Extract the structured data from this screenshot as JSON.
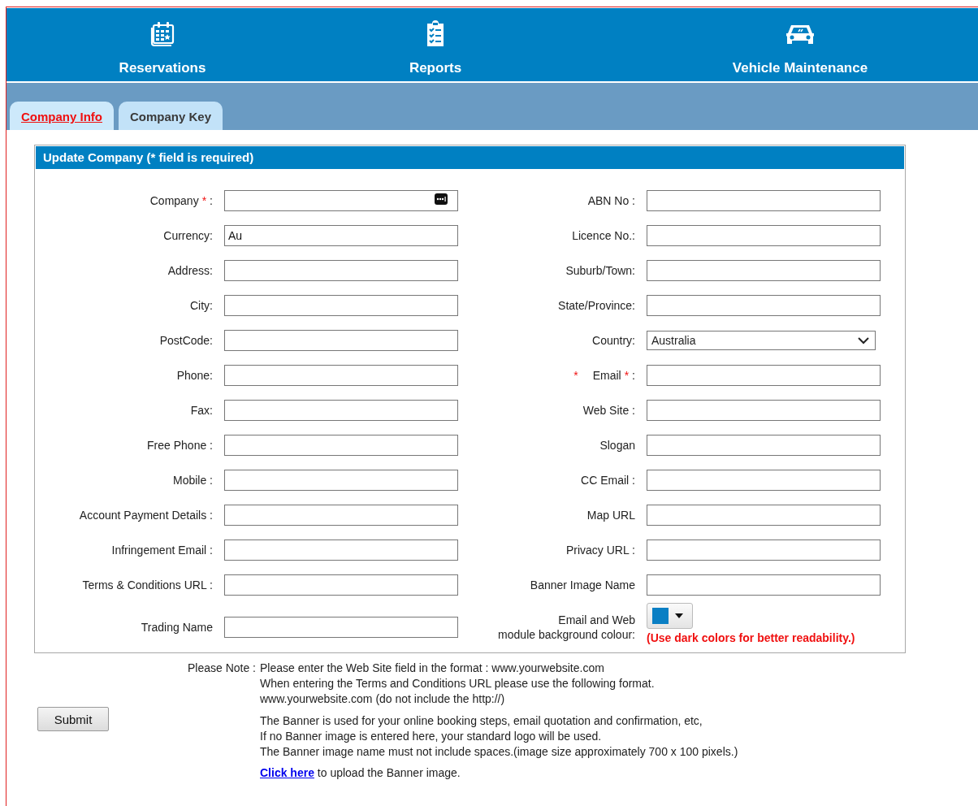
{
  "nav": [
    {
      "label": "Reservations"
    },
    {
      "label": "Reports"
    },
    {
      "label": "Vehicle Maintenance"
    }
  ],
  "tabs": [
    {
      "label": "Company Info",
      "selected": true
    },
    {
      "label": "Company Key",
      "selected": false
    }
  ],
  "form": {
    "title": "Update Company (* field is required)",
    "rows": [
      {
        "left": {
          "kind": "text",
          "label": [
            {
              "kind": "plain",
              "text": "Company"
            },
            {
              "kind": "required",
              "text": "*"
            },
            {
              "kind": "plain",
              "text": ":"
            }
          ],
          "autofill_icon": true
        },
        "right": {
          "kind": "text",
          "label": [
            {
              "kind": "plain",
              "text": "ABN No :"
            }
          ]
        }
      },
      {
        "left": {
          "kind": "text",
          "label": [
            {
              "kind": "plain",
              "text": "Currency:"
            }
          ],
          "value": "Au"
        },
        "right": {
          "kind": "text",
          "label": [
            {
              "kind": "plain",
              "text": "Licence No.:"
            }
          ]
        }
      },
      {
        "left": {
          "kind": "text",
          "label": [
            {
              "kind": "plain",
              "text": "Address:"
            }
          ]
        },
        "right": {
          "kind": "text",
          "label": [
            {
              "kind": "plain",
              "text": "Suburb/Town:"
            }
          ]
        }
      },
      {
        "left": {
          "kind": "text",
          "label": [
            {
              "kind": "plain",
              "text": "City:"
            }
          ]
        },
        "right": {
          "kind": "text",
          "label": [
            {
              "kind": "plain",
              "text": "State/Province:"
            }
          ]
        }
      },
      {
        "left": {
          "kind": "text",
          "label": [
            {
              "kind": "plain",
              "text": "PostCode:"
            }
          ]
        },
        "right": {
          "kind": "select",
          "label": [
            {
              "kind": "plain",
              "text": "Country:"
            }
          ],
          "value": "Australia"
        }
      },
      {
        "left": {
          "kind": "text",
          "label": [
            {
              "kind": "plain",
              "text": "Phone:"
            }
          ]
        },
        "right": {
          "kind": "text",
          "label": [
            {
              "kind": "required",
              "text": "*"
            },
            {
              "kind": "plain",
              "text": "Email"
            },
            {
              "kind": "required",
              "text": "*"
            },
            {
              "kind": "plain",
              "text": ":"
            }
          ]
        }
      },
      {
        "left": {
          "kind": "text",
          "label": [
            {
              "kind": "plain",
              "text": "Fax:"
            }
          ]
        },
        "right": {
          "kind": "text",
          "label": [
            {
              "kind": "plain",
              "text": "Web Site :"
            }
          ]
        }
      },
      {
        "left": {
          "kind": "text",
          "label": [
            {
              "kind": "plain",
              "text": "Free Phone :"
            }
          ]
        },
        "right": {
          "kind": "text",
          "label": [
            {
              "kind": "plain",
              "text": "Slogan"
            }
          ]
        }
      },
      {
        "left": {
          "kind": "text",
          "label": [
            {
              "kind": "plain",
              "text": "Mobile :"
            }
          ]
        },
        "right": {
          "kind": "text",
          "label": [
            {
              "kind": "plain",
              "text": "CC Email :"
            }
          ]
        }
      },
      {
        "left": {
          "kind": "text",
          "label": [
            {
              "kind": "plain",
              "text": "Account Payment Details :"
            }
          ]
        },
        "right": {
          "kind": "text",
          "label": [
            {
              "kind": "plain",
              "text": "Map URL"
            }
          ]
        }
      },
      {
        "left": {
          "kind": "text",
          "label": [
            {
              "kind": "plain",
              "text": "Infringement Email :"
            }
          ]
        },
        "right": {
          "kind": "text",
          "label": [
            {
              "kind": "plain",
              "text": "Privacy URL :"
            }
          ]
        }
      },
      {
        "left": {
          "kind": "text",
          "label": [
            {
              "kind": "plain",
              "text": "Terms & Conditions URL :"
            }
          ]
        },
        "right": {
          "kind": "text",
          "label": [
            {
              "kind": "plain",
              "text": "Banner Image Name"
            }
          ]
        }
      },
      {
        "left": {
          "kind": "text",
          "label": [
            {
              "kind": "plain",
              "text": "Trading Name"
            }
          ]
        },
        "right": {
          "kind": "color",
          "label": [
            {
              "kind": "plain",
              "text": "Email and Web"
            },
            {
              "kind": "plain",
              "text": "module background colour:"
            }
          ],
          "color": "#0a7fc4",
          "note": "(Use dark colors for better readability.)"
        }
      }
    ]
  },
  "notes": {
    "label": "Please Note :",
    "paragraphs": [
      [
        "Please enter the Web Site field in the format : www.yourwebsite.com",
        "When entering the Terms and Conditions URL please use the following format.",
        "www.yourwebsite.com (do not include the http://)"
      ],
      [
        "The Banner is used for your online booking steps, email quotation and confirmation, etc,",
        "If no Banner image is entered here, your standard logo will be used.",
        "The Banner image name must not include spaces.(image size approximately 700 x 100 pixels.)"
      ]
    ],
    "upload": {
      "link": "Click here",
      "text": " to upload the Banner image."
    }
  },
  "submit": "Submit"
}
